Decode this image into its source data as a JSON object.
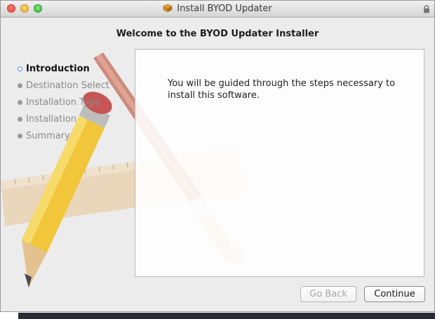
{
  "window": {
    "title": "Install BYOD Updater"
  },
  "heading": "Welcome to the BYOD Updater Installer",
  "steps": [
    {
      "label": "Introduction",
      "active": true
    },
    {
      "label": "Destination Select",
      "active": false
    },
    {
      "label": "Installation Type",
      "active": false
    },
    {
      "label": "Installation",
      "active": false
    },
    {
      "label": "Summary",
      "active": false
    }
  ],
  "content": {
    "text": "You will be guided through the steps necessary to install this software."
  },
  "buttons": {
    "back_label": "Go Back",
    "back_enabled": false,
    "continue_label": "Continue"
  },
  "icons": {
    "close": "close-icon",
    "minimize": "minimize-icon",
    "zoom": "zoom-icon",
    "package": "package-icon",
    "lock": "lock-icon"
  },
  "colors": {
    "active_step_dot": "#4f8ee4"
  }
}
